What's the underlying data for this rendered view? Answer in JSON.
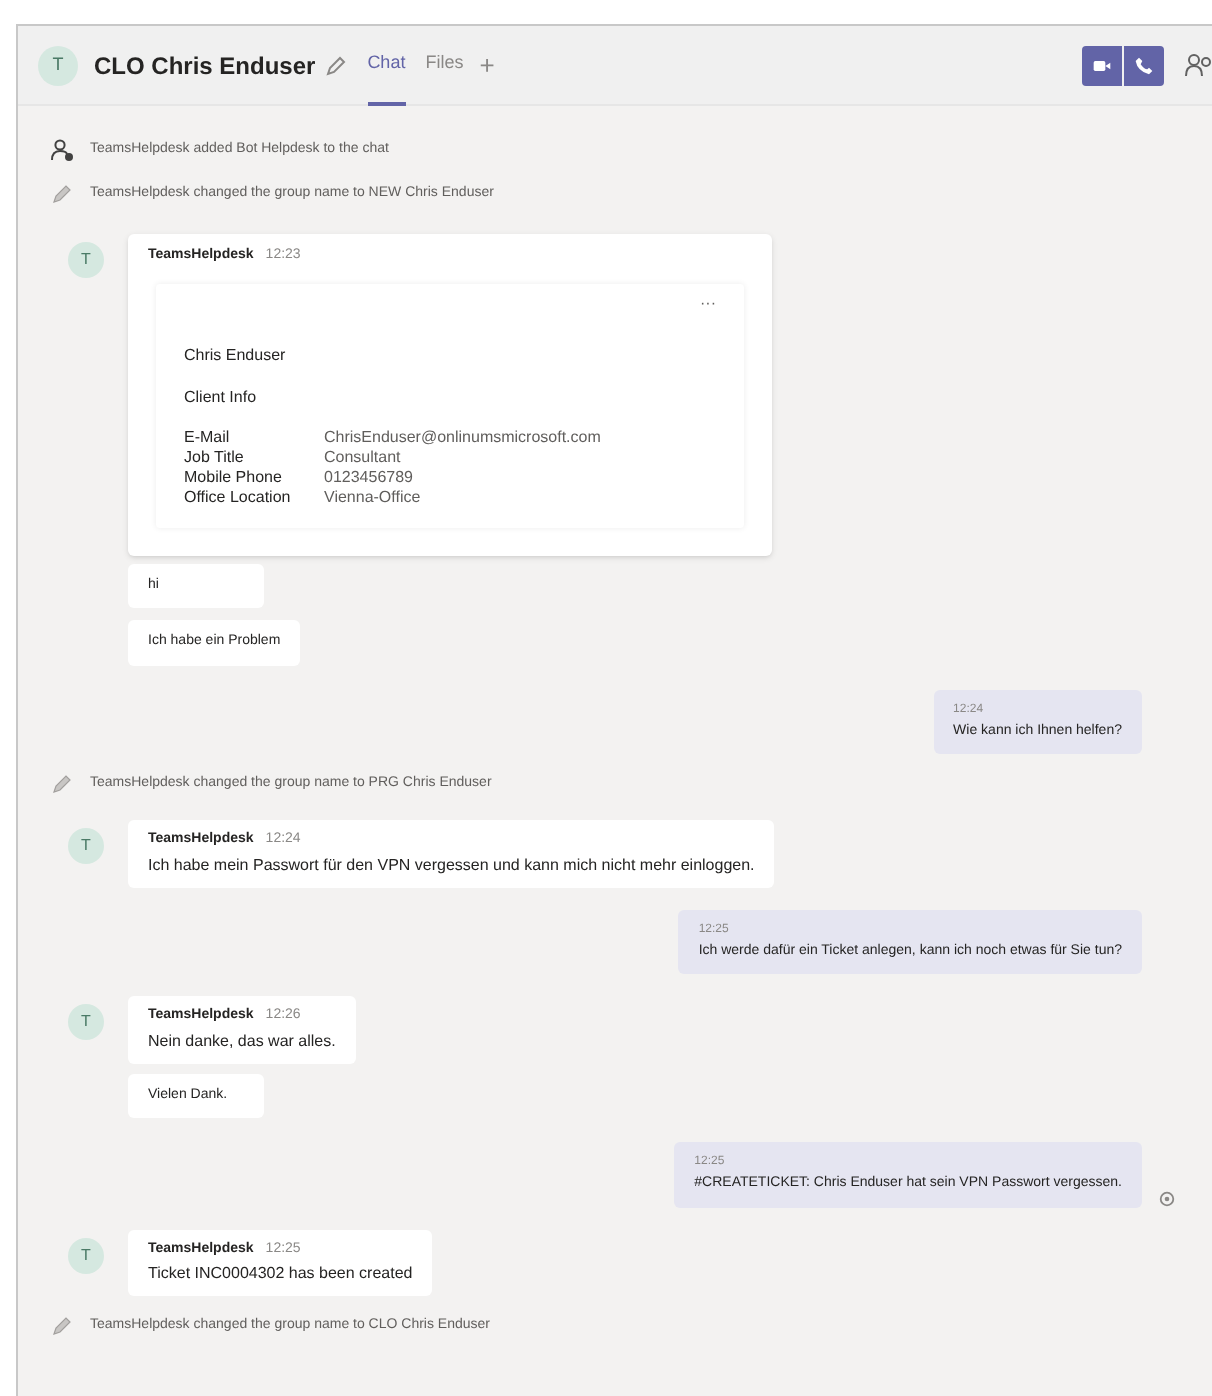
{
  "header": {
    "avatar": "T",
    "title": "CLO Chris Enduser",
    "tabs": [
      {
        "label": "Chat",
        "selected": true
      },
      {
        "label": "Files",
        "selected": false
      }
    ],
    "add_tab": "+"
  },
  "messages": [
    {
      "kind": "member_added",
      "text": "TeamsHelpdesk added Bot Helpdesk to the chat"
    },
    {
      "kind": "rename",
      "text": "TeamsHelpdesk changed the group name to NEW Chris Enduser"
    },
    {
      "kind": "card",
      "avatar": "T",
      "sender": "TeamsHelpdesk",
      "time": "12:23",
      "more": "···",
      "name": "Chris Enduser",
      "subtitle": "Client Info",
      "fields": [
        {
          "label": "E-Mail",
          "value": "ChrisEnduser@onlinumsmicrosoft.com"
        },
        {
          "label": "Job Title",
          "value": "Consultant"
        },
        {
          "label": "Mobile Phone",
          "value": "0123456789"
        },
        {
          "label": "Office Location",
          "value": "Vienna-Office"
        }
      ]
    },
    {
      "kind": "continuation",
      "text": "hi"
    },
    {
      "kind": "continuation",
      "text": "Ich habe ein Problem"
    },
    {
      "kind": "outgoing",
      "time": "12:24",
      "text": "Wie kann ich Ihnen helfen?"
    },
    {
      "kind": "rename",
      "text": "TeamsHelpdesk changed the group name to PRG Chris Enduser"
    },
    {
      "kind": "incoming",
      "avatar": "T",
      "sender": "TeamsHelpdesk",
      "time": "12:24",
      "text": "Ich habe mein Passwort für den VPN vergessen und kann mich nicht mehr einloggen."
    },
    {
      "kind": "outgoing",
      "time": "12:25",
      "text": "Ich werde dafür ein Ticket anlegen, kann ich noch etwas für Sie tun?"
    },
    {
      "kind": "incoming",
      "avatar": "T",
      "sender": "TeamsHelpdesk",
      "time": "12:26",
      "text": "Nein danke, das war alles."
    },
    {
      "kind": "continuation",
      "text": "Vielen Dank."
    },
    {
      "kind": "outgoing",
      "time": "12:25",
      "text": "#CREATETICKET: Chris Enduser hat sein VPN Passwort vergessen.",
      "seen": true
    },
    {
      "kind": "incoming",
      "avatar": "T",
      "sender": "TeamsHelpdesk",
      "time": "12:25",
      "text": "Ticket INC0004302 has been created"
    },
    {
      "kind": "rename",
      "text": "TeamsHelpdesk changed the group name to CLO Chris Enduser"
    }
  ]
}
